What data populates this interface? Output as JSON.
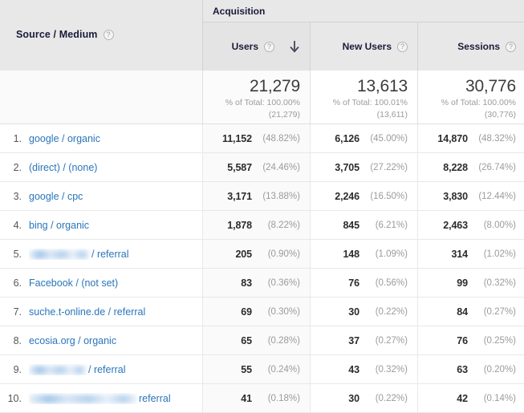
{
  "table": {
    "dimension_header": {
      "label": "Source / Medium",
      "help_icon": "help-circle-icon",
      "help_glyph": "?"
    },
    "group_header": {
      "label": "Acquisition"
    },
    "metric_headers": [
      {
        "label": "Users",
        "help_glyph": "?",
        "sorted": true,
        "sort_direction": "descending",
        "sort_glyph": "down-arrow"
      },
      {
        "label": "New Users",
        "help_glyph": "?",
        "sorted": false
      },
      {
        "label": "Sessions",
        "help_glyph": "?",
        "sorted": false
      }
    ],
    "summary": [
      {
        "value": "21,279",
        "pct_of_total": "% of Total: 100.00%",
        "total": "(21,279)"
      },
      {
        "value": "13,613",
        "pct_of_total": "% of Total: 100.01%",
        "total": "(13,611)"
      },
      {
        "value": "30,776",
        "pct_of_total": "% of Total: 100.00%",
        "total": "(30,776)"
      }
    ],
    "rows": [
      {
        "index": "1.",
        "source_medium": "google / organic",
        "redacted": false,
        "users": "11,152",
        "users_pct": "(48.82%)",
        "new_users": "6,126",
        "new_users_pct": "(45.00%)",
        "sessions": "14,870",
        "sessions_pct": "(48.32%)"
      },
      {
        "index": "2.",
        "source_medium": "(direct) / (none)",
        "redacted": false,
        "users": "5,587",
        "users_pct": "(24.46%)",
        "new_users": "3,705",
        "new_users_pct": "(27.22%)",
        "sessions": "8,228",
        "sessions_pct": "(26.74%)"
      },
      {
        "index": "3.",
        "source_medium": "google / cpc",
        "redacted": false,
        "users": "3,171",
        "users_pct": "(13.88%)",
        "new_users": "2,246",
        "new_users_pct": "(16.50%)",
        "sessions": "3,830",
        "sessions_pct": "(12.44%)"
      },
      {
        "index": "4.",
        "source_medium": "bing / organic",
        "redacted": false,
        "users": "1,878",
        "users_pct": "(8.22%)",
        "new_users": "845",
        "new_users_pct": "(6.21%)",
        "sessions": "2,463",
        "sessions_pct": "(8.00%)"
      },
      {
        "index": "5.",
        "source_medium": "/ referral",
        "redacted": true,
        "redacted_width": 76,
        "users": "205",
        "users_pct": "(0.90%)",
        "new_users": "148",
        "new_users_pct": "(1.09%)",
        "sessions": "314",
        "sessions_pct": "(1.02%)"
      },
      {
        "index": "6.",
        "source_medium": "Facebook / (not set)",
        "redacted": false,
        "users": "83",
        "users_pct": "(0.36%)",
        "new_users": "76",
        "new_users_pct": "(0.56%)",
        "sessions": "99",
        "sessions_pct": "(0.32%)"
      },
      {
        "index": "7.",
        "source_medium": "suche.t-online.de / referral",
        "redacted": false,
        "users": "69",
        "users_pct": "(0.30%)",
        "new_users": "30",
        "new_users_pct": "(0.22%)",
        "sessions": "84",
        "sessions_pct": "(0.27%)"
      },
      {
        "index": "8.",
        "source_medium": "ecosia.org / organic",
        "redacted": false,
        "users": "65",
        "users_pct": "(0.28%)",
        "new_users": "37",
        "new_users_pct": "(0.27%)",
        "sessions": "76",
        "sessions_pct": "(0.25%)"
      },
      {
        "index": "9.",
        "source_medium": "/ referral",
        "redacted": true,
        "redacted_width": 72,
        "users": "55",
        "users_pct": "(0.24%)",
        "new_users": "43",
        "new_users_pct": "(0.32%)",
        "sessions": "63",
        "sessions_pct": "(0.20%)"
      },
      {
        "index": "10.",
        "source_medium": "referral",
        "redacted": true,
        "redacted_width": 135,
        "users": "41",
        "users_pct": "(0.18%)",
        "new_users": "30",
        "new_users_pct": "(0.22%)",
        "sessions": "42",
        "sessions_pct": "(0.14%)"
      }
    ]
  },
  "colors": {
    "link": "#2a75bb",
    "header_bg": "#e8e8e8",
    "header_text": "#1b1b3a",
    "muted_text": "#9b9b9b"
  }
}
